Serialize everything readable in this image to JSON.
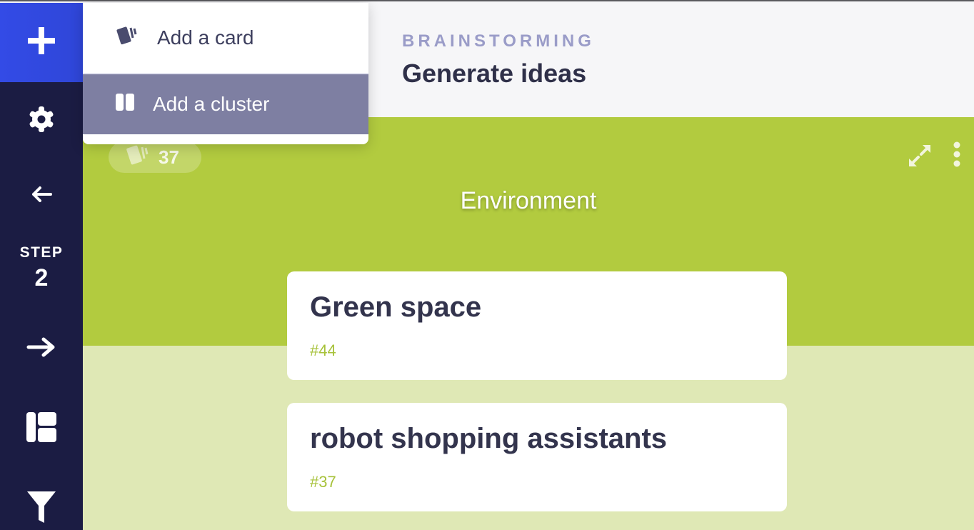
{
  "sidebar": {
    "add_icon": "plus-icon",
    "settings_icon": "gear-icon",
    "prev_icon": "arrow-left-icon",
    "step_label": "STEP",
    "step_number": "2",
    "next_icon": "arrow-right-icon",
    "layout_icon": "layout-icon",
    "filter_icon": "filter-icon"
  },
  "menu": {
    "items": [
      {
        "label": "Add a card",
        "icon": "card-icon"
      },
      {
        "label": "Add a cluster",
        "icon": "cluster-icon",
        "highlighted": true
      }
    ]
  },
  "header": {
    "subtitle": "BRAINSTORMING",
    "title": "Generate ideas"
  },
  "cluster": {
    "title": "Environment",
    "card_count": "37",
    "color": "#b2cb3f",
    "light_color": "#dfe8b5"
  },
  "cards": [
    {
      "title": "Green space",
      "id": "#44"
    },
    {
      "title": "robot shopping assistants",
      "id": "#37"
    }
  ]
}
